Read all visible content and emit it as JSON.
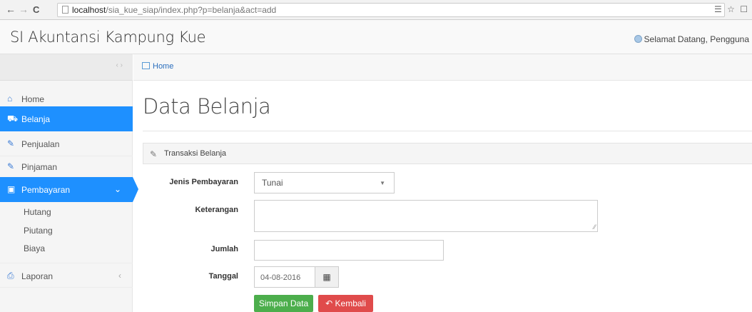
{
  "browser": {
    "back": "←",
    "forward": "→",
    "reload": "C",
    "url_host": "localhost",
    "url_path": "/sia_kue_siap/index.php?p=belanja&act=add",
    "ext_icons": "☰ ☆ ☐"
  },
  "header": {
    "app_title": "SI Akuntansi Kampung Kue",
    "welcome": "Selamat Datang, Pengguna"
  },
  "sidebar": {
    "collapse_glyph": "‹ ›",
    "items": [
      {
        "label": "Home",
        "icon": "⌂"
      },
      {
        "label": "Belanja",
        "icon": "⛟"
      },
      {
        "label": "Penjualan",
        "icon": "✎"
      },
      {
        "label": "Pinjaman",
        "icon": "✎"
      },
      {
        "label": "Pembayaran",
        "icon": "▣",
        "arrow": "⌄"
      },
      {
        "label": "Laporan",
        "icon": "⎙",
        "arrow": "‹"
      }
    ],
    "submenu": [
      "Hutang",
      "Piutang",
      "Biaya"
    ]
  },
  "breadcrumb": {
    "label": "Home"
  },
  "page": {
    "title": "Data Belanja"
  },
  "panel": {
    "title": "Transaksi Belanja",
    "icon": "✎"
  },
  "form": {
    "jenis_label": "Jenis Pembayaran",
    "jenis_value": "Tunai",
    "keterangan_label": "Keterangan",
    "keterangan_value": "",
    "jumlah_label": "Jumlah",
    "jumlah_value": "",
    "tanggal_label": "Tanggal",
    "tanggal_value": "04-08-2016",
    "calendar_icon": "▦"
  },
  "buttons": {
    "save": "Simpan Data",
    "back": "Kembali",
    "back_icon": "↶"
  },
  "colors": {
    "active_menu": "#1e90ff",
    "save_button": "#4cae4c",
    "back_button": "#e04b4b"
  }
}
